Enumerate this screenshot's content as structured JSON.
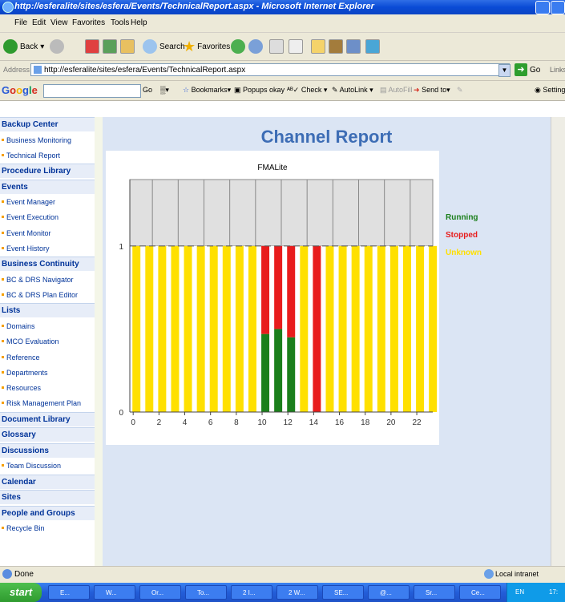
{
  "window": {
    "title": "http://esferalite/sites/esfera/Events/TechnicalReport.aspx - Microsoft Internet Explorer"
  },
  "menu": [
    "File",
    "Edit",
    "View",
    "Favorites",
    "Tools",
    "Help"
  ],
  "toolbar": {
    "back": "Back",
    "search": "Search",
    "favorites": "Favorites"
  },
  "address": {
    "label": "Address",
    "url": "http://esferalite/sites/esfera/Events/TechnicalReport.aspx",
    "go": "Go",
    "links": "Links"
  },
  "google_bar": {
    "go": "Go",
    "bookmarks": "Bookmarks",
    "popups": "Popups okay",
    "check": "Check",
    "autolink": "AutoLink",
    "autofill": "AutoFill",
    "sendto": "Send to",
    "settings": "Settings"
  },
  "sidebar": [
    {
      "type": "header",
      "label": "Backup Center"
    },
    {
      "type": "item",
      "label": "Business Monitoring"
    },
    {
      "type": "item",
      "label": "Technical Report"
    },
    {
      "type": "header",
      "label": "Procedure Library"
    },
    {
      "type": "header",
      "label": "Events"
    },
    {
      "type": "item",
      "label": "Event Manager"
    },
    {
      "type": "item",
      "label": "Event Execution"
    },
    {
      "type": "item",
      "label": "Event Monitor"
    },
    {
      "type": "item",
      "label": "Event History"
    },
    {
      "type": "header",
      "label": "Business Continuity"
    },
    {
      "type": "item",
      "label": "BC & DRS Navigator"
    },
    {
      "type": "item",
      "label": "BC & DRS Plan Editor"
    },
    {
      "type": "header",
      "label": "Lists"
    },
    {
      "type": "item",
      "label": "Domains"
    },
    {
      "type": "item",
      "label": "MCO Evaluation"
    },
    {
      "type": "item",
      "label": "Reference"
    },
    {
      "type": "item",
      "label": "Departments"
    },
    {
      "type": "item",
      "label": "Resources"
    },
    {
      "type": "item",
      "label": "Risk Management Plan"
    },
    {
      "type": "header",
      "label": "Document Library"
    },
    {
      "type": "header",
      "label": "Glossary"
    },
    {
      "type": "header",
      "label": "Discussions"
    },
    {
      "type": "item",
      "label": "Team Discussion"
    },
    {
      "type": "header",
      "label": "Calendar"
    },
    {
      "type": "header",
      "label": "Sites"
    },
    {
      "type": "header",
      "label": "People and Groups"
    },
    {
      "type": "item",
      "label": "Recycle Bin"
    }
  ],
  "page": {
    "title": "Channel Report"
  },
  "status": {
    "text": "Done",
    "zone": "Local intranet"
  },
  "taskbar": {
    "start": "start",
    "tasks": [
      "E...",
      "W...",
      "Or...",
      "To...",
      "2 I...",
      "2 W...",
      "SE...",
      "@...",
      "Sr...",
      "Ce..."
    ],
    "lang": "EN",
    "clock": "17:"
  },
  "colors": {
    "running": "#1b7f1b",
    "stopped": "#e81c1c",
    "unknown": "#ffe000"
  },
  "chart_data": {
    "type": "bar",
    "title": "FMALite",
    "x": [
      0,
      1,
      2,
      3,
      4,
      5,
      6,
      7,
      8,
      9,
      10,
      11,
      12,
      13,
      14,
      15,
      16,
      17,
      18,
      19,
      20,
      21,
      22,
      23
    ],
    "xticks": [
      0,
      2,
      4,
      6,
      8,
      10,
      12,
      14,
      16,
      18,
      20,
      22
    ],
    "yticks": [
      0,
      1
    ],
    "ylim": [
      0,
      1.4
    ],
    "series": [
      {
        "name": "Running",
        "color": "#1b7f1b",
        "values": [
          0,
          0,
          0,
          0,
          0,
          0,
          0,
          0,
          0,
          0,
          0.47,
          0.5,
          0.45,
          0,
          0,
          0,
          0,
          0,
          0,
          0,
          0,
          0,
          0,
          0
        ]
      },
      {
        "name": "Stopped",
        "color": "#e81c1c",
        "values": [
          0,
          0,
          0,
          0,
          0,
          0,
          0,
          0,
          0,
          0,
          0.53,
          0.5,
          0.55,
          0,
          1,
          0,
          0,
          0,
          0,
          0,
          0,
          0,
          0,
          0
        ]
      },
      {
        "name": "Unknown",
        "color": "#ffe000",
        "values": [
          1,
          1,
          1,
          1,
          1,
          1,
          1,
          1,
          1,
          1,
          0,
          0,
          0,
          1,
          0,
          1,
          1,
          1,
          1,
          1,
          1,
          1,
          1,
          1
        ]
      }
    ],
    "stacked": true,
    "legend_position": "right"
  }
}
